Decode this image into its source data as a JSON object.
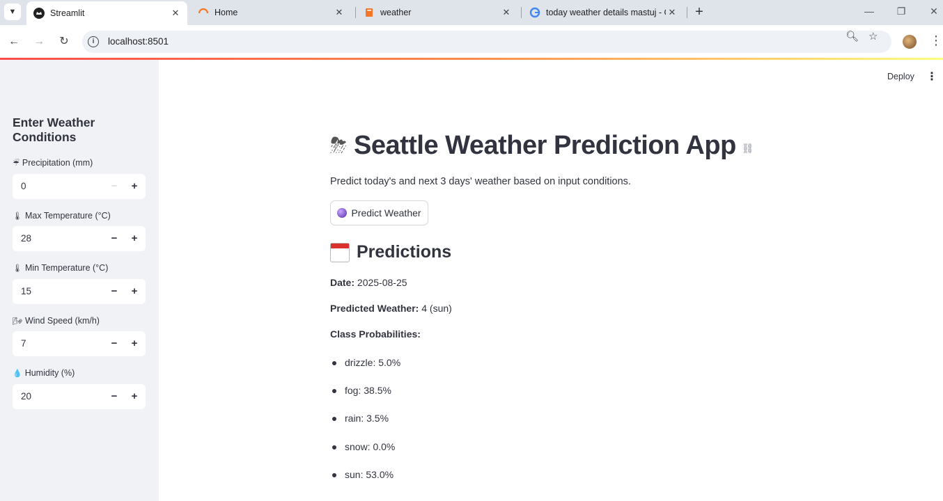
{
  "browser": {
    "tabs": [
      {
        "title": "Streamlit",
        "icon": "streamlit-crown-icon",
        "active": true
      },
      {
        "title": "Home",
        "icon": "loader-icon",
        "active": false
      },
      {
        "title": "weather",
        "icon": "book-icon",
        "active": false
      },
      {
        "title": "today weather details mastuj - G",
        "icon": "google-icon",
        "active": false
      }
    ],
    "url": "localhost:8501"
  },
  "sidebar": {
    "title": "Enter Weather Conditions",
    "fields": [
      {
        "icon": "☔",
        "label": "Precipitation (mm)",
        "value": "0",
        "minus_disabled": true
      },
      {
        "icon": "🌡",
        "label": "Max Temperature (°C)",
        "value": "28",
        "minus_disabled": false
      },
      {
        "icon": "🌡",
        "label": "Min Temperature (°C)",
        "value": "15",
        "minus_disabled": false
      },
      {
        "icon": "🌬",
        "label": "Wind Speed (km/h)",
        "value": "7",
        "minus_disabled": false
      },
      {
        "icon": "💧",
        "label": "Humidity (%)",
        "value": "20",
        "minus_disabled": false
      }
    ]
  },
  "header": {
    "deploy_label": "Deploy"
  },
  "main": {
    "title": "Seattle Weather Prediction App",
    "title_emoji": "⛈",
    "subtitle": "Predict today's and next 3 days' weather based on input conditions.",
    "predict_button": "Predict Weather",
    "predictions_heading": "Predictions",
    "date_label": "Date:",
    "date_value": "2025-08-25",
    "predicted_label": "Predicted Weather:",
    "predicted_value": "4 (sun)",
    "probs_label": "Class Probabilities:",
    "probabilities": [
      "drizzle: 5.0%",
      "fog: 38.5%",
      "rain: 3.5%",
      "snow: 0.0%",
      "sun: 53.0%"
    ]
  }
}
